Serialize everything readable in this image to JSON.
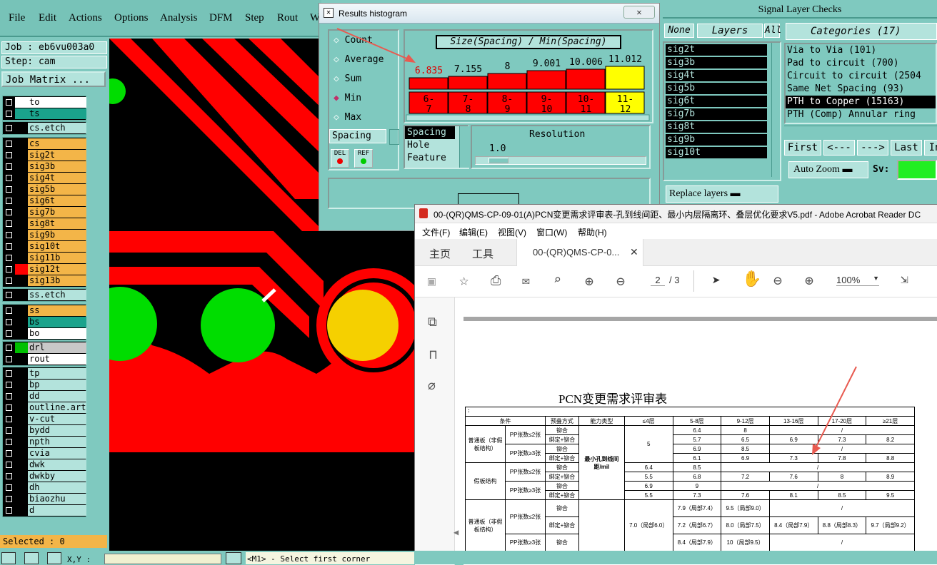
{
  "menubar": {
    "items": [
      "File",
      "Edit",
      "Actions",
      "Options",
      "Analysis",
      "DFM",
      "Step",
      "Rout",
      "W"
    ]
  },
  "job": {
    "job_line": "Job : eb6vu003a0",
    "step_line": "Step: cam",
    "matrix_button": "Job Matrix ..."
  },
  "layers": {
    "group1": [
      "to",
      "ts"
    ],
    "group2": [
      "cs.etch"
    ],
    "group3": [
      "cs",
      "sig2t",
      "sig3b",
      "sig4t",
      "sig5b",
      "sig6t",
      "sig7b",
      "sig8t",
      "sig9b",
      "sig10t",
      "sig11b",
      "sig12t",
      "sig13b"
    ],
    "group4": [
      "ss.etch"
    ],
    "group5": [
      "ss",
      "bs",
      "bo"
    ],
    "group6": [
      "drl",
      "rout"
    ],
    "group7": [
      "tp",
      "bp",
      "dd",
      "outline.art",
      "v-cut",
      "bydd",
      "npth",
      "cvia",
      "dwk",
      "dwkby",
      "dh",
      "biaozhu",
      "d"
    ]
  },
  "selected": "Selected : 0",
  "status": {
    "xy_label": "X,Y :",
    "prompt": "<M1> - Select first corner"
  },
  "histogram": {
    "window_title": "Results histogram",
    "modes": [
      "Count",
      "Average",
      "Sum",
      "Min",
      "Max"
    ],
    "selected_mode": "Min",
    "chart_title": "Size(Spacing) / Min(Spacing)",
    "bar_values": [
      "6.835",
      "7.155",
      "8",
      "9.001",
      "10.006",
      "11.012"
    ],
    "bar_ranges": [
      "6-\n7",
      "7-\n8",
      "8-\n9",
      "9-\n10",
      "10-\n11",
      "11-\n12"
    ],
    "bar_colors": [
      "#ff0000",
      "#ff0000",
      "#ff0000",
      "#ff0000",
      "#ff0000",
      "#ffff00"
    ],
    "measure_select": "Spacing",
    "del_label": "DEL",
    "ref_label": "REF",
    "list": [
      "Spacing",
      "Hole",
      "Feature"
    ],
    "resolution_label": "Resolution",
    "resolution_value": "1.0"
  },
  "signal_checks": {
    "title": "Signal Layer Checks",
    "none_btn": "None",
    "layers_btn": "Layers",
    "all_btn": "All",
    "layer_list": [
      "sig2t",
      "sig3b",
      "sig4t",
      "sig5b",
      "sig6t",
      "sig7b",
      "sig8t",
      "sig9b",
      "sig10t"
    ],
    "categories_title": "Categories (17)",
    "categories": [
      "Via to Via (101)",
      "Pad to circuit (700)",
      "Circuit to circuit (2504",
      "Same Net Spacing (93)",
      "PTH to Copper (15163)",
      "PTH (Comp) Annular ring"
    ],
    "nav": [
      "First",
      "<---",
      "--->",
      "Last",
      "In"
    ],
    "auto_zoom": "Auto Zoom",
    "sv_label": "Sv:",
    "replace_layers": "Replace layers"
  },
  "acrobat": {
    "title": "00-(QR)QMS-CP-09-01(A)PCN变更需求评审表-孔到线间距、最小内层隔离环、叠层优化要求V5.pdf - Adobe Acrobat Reader DC",
    "menu": [
      "文件(F)",
      "编辑(E)",
      "视图(V)",
      "窗口(W)",
      "帮助(H)"
    ],
    "tabs": [
      "主页",
      "工具",
      "00-(QR)QMS-CP-0..."
    ],
    "page_current": "2",
    "page_total": "/ 3",
    "zoom": "100%",
    "doc_title": "PCN变更需求评审表",
    "table_headers": [
      "条件",
      "",
      "预叠方式",
      "能力类型",
      "≤4层",
      "5-8层",
      "9-12层",
      "13-16层",
      "17-20层",
      "≥21层"
    ],
    "row_group1": "普通板（非假板结构）",
    "row_group2": "假板结构",
    "pp_le2": "PP张数≤2张",
    "pp_ge3": "PP张数≥3张",
    "mao": "铆合",
    "bang": "绑定+铆合",
    "capability": "最小孔到线间距/mil",
    "r1": [
      "6.4",
      "8",
      "/"
    ],
    "r2": [
      "5.7",
      "6.5",
      "6.9",
      "7.3",
      "8.2"
    ],
    "r3": [
      "6.9",
      "8.5",
      "/"
    ],
    "r4": [
      "6.1",
      "6.9",
      "7.3",
      "7.8",
      "8.8"
    ],
    "c_le4": "5",
    "r5": [
      "6.4",
      "8.5",
      "/"
    ],
    "r6": [
      "5.5",
      "6.8",
      "7.2",
      "7.6",
      "8",
      "8.9"
    ],
    "r7": [
      "6.9",
      "9",
      "/"
    ],
    "r8": [
      "5.5",
      "7.3",
      "7.6",
      "8.1",
      "8.5",
      "9.5"
    ],
    "r9": [
      "7.9（局部7.4）",
      "9.5（局部9.0）",
      "/"
    ],
    "r10": [
      "7.2（局部6.7）",
      "8.0（局部7.5）",
      "8.4（局部7.9）",
      "8.8（局部8.3）",
      "9.7（局部9.2）"
    ],
    "r11": [
      "8.4（局部7.9）",
      "10（局部9.5）",
      "/"
    ],
    "c2_le4": "7.0（局部6.0）"
  }
}
